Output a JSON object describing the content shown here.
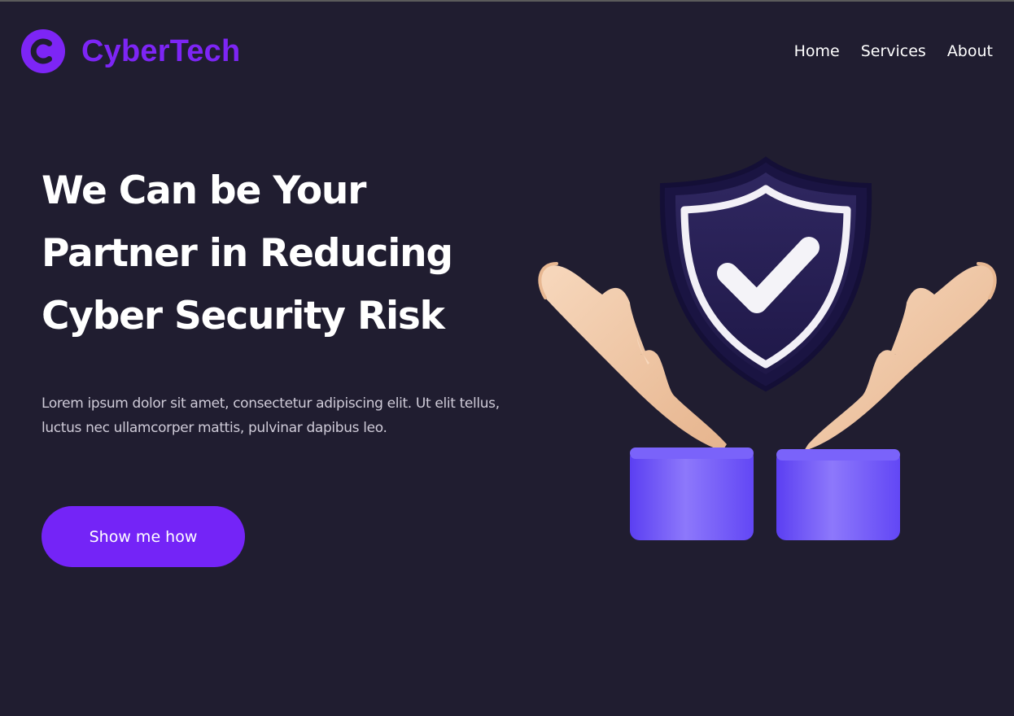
{
  "brand": {
    "name": "CyberTech",
    "logo_letter": "C",
    "color": "#7d25f5"
  },
  "nav": {
    "items": [
      {
        "label": "Home"
      },
      {
        "label": "Services"
      },
      {
        "label": "About"
      }
    ]
  },
  "hero": {
    "title_lines": [
      "We Can be Your",
      "Partner in Reducing",
      "Cyber Security Risk"
    ],
    "description": "Lorem ipsum dolor sit amet, consectetur adipiscing elit. Ut elit tellus, luctus nec ullamcorper mattis, pulvinar dapibus leo.",
    "cta_label": "Show me how"
  },
  "illustration": {
    "icons": [
      "shield-check-icon",
      "open-hand-left-icon",
      "open-hand-right-icon"
    ]
  },
  "colors": {
    "background": "#201d30",
    "accent": "#7424f7",
    "text": "#ffffff",
    "muted_text": "#cfcbd8",
    "shield": "#2b2553",
    "skin": "#f2c9a6",
    "sleeve": "#6a4cf7"
  }
}
